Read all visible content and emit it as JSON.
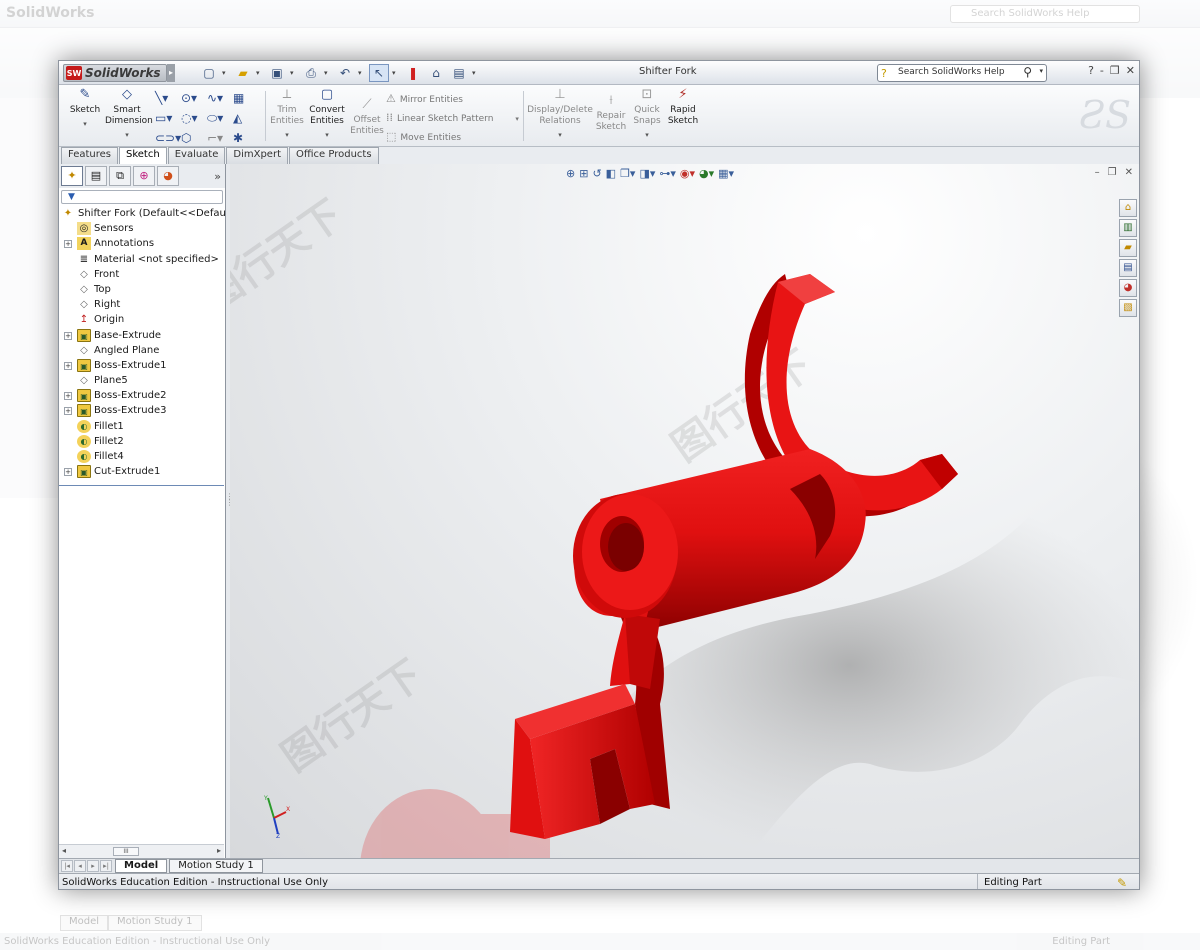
{
  "app": {
    "name": "SolidWorks",
    "document_title": "Shifter Fork",
    "search_placeholder": "Search SolidWorks Help",
    "window_controls": [
      "?",
      "-",
      "❐",
      "✕"
    ]
  },
  "command_manager": {
    "sketch": "Sketch",
    "smart_dimension": "Smart Dimension",
    "trim_entities": "Trim Entities",
    "convert_entities": "Convert Entities",
    "offset_entities": "Offset Entities",
    "mirror_entities": "Mirror Entities",
    "linear_sketch_pattern": "Linear Sketch Pattern",
    "move_entities": "Move Entities",
    "display_delete_relations": "Display/Delete Relations",
    "repair_sketch": "Repair Sketch",
    "quick_snaps": "Quick Snaps",
    "rapid_sketch": "Rapid Sketch"
  },
  "tabs": [
    "Features",
    "Sketch",
    "Evaluate",
    "DimXpert",
    "Office Products"
  ],
  "active_tab": "Sketch",
  "feature_tree": {
    "root": "Shifter Fork  (Default<<Default>",
    "items": [
      {
        "label": "Sensors",
        "icon": "sensor-icon",
        "expand": false
      },
      {
        "label": "Annotations",
        "icon": "annotations-icon",
        "expand": true
      },
      {
        "label": "Material <not specified>",
        "icon": "material-icon",
        "expand": false
      },
      {
        "label": "Front",
        "icon": "plane-icon",
        "expand": false
      },
      {
        "label": "Top",
        "icon": "plane-icon",
        "expand": false
      },
      {
        "label": "Right",
        "icon": "plane-icon",
        "expand": false
      },
      {
        "label": "Origin",
        "icon": "origin-icon",
        "expand": false
      },
      {
        "label": "Base-Extrude",
        "icon": "extrude-icon",
        "expand": true
      },
      {
        "label": "Angled Plane",
        "icon": "plane-icon",
        "expand": false
      },
      {
        "label": "Boss-Extrude1",
        "icon": "extrude-icon",
        "expand": true
      },
      {
        "label": "Plane5",
        "icon": "plane-icon",
        "expand": false
      },
      {
        "label": "Boss-Extrude2",
        "icon": "extrude-icon",
        "expand": true
      },
      {
        "label": "Boss-Extrude3",
        "icon": "extrude-icon",
        "expand": true
      },
      {
        "label": "Fillet1",
        "icon": "fillet-icon",
        "expand": false
      },
      {
        "label": "Fillet2",
        "icon": "fillet-icon",
        "expand": false
      },
      {
        "label": "Fillet4",
        "icon": "fillet-icon",
        "expand": false
      },
      {
        "label": "Cut-Extrude1",
        "icon": "cut-extrude-icon",
        "expand": true
      }
    ]
  },
  "bottom_tabs": [
    "Model",
    "Motion Study 1"
  ],
  "status": {
    "message": "SolidWorks Education Edition - Instructional Use Only",
    "mode": "Editing Part"
  },
  "colors": {
    "part_red": "#e01010",
    "accent_blue": "#2b4b8c"
  }
}
